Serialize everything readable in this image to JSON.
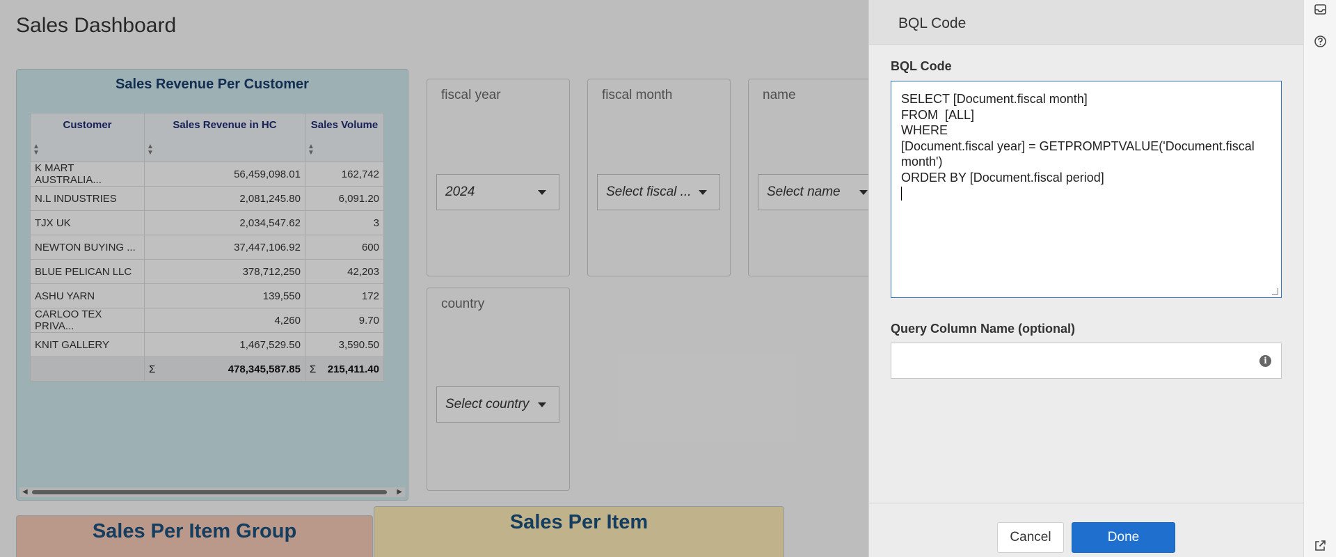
{
  "dashboard": {
    "title": "Sales Dashboard",
    "revenue_panel": {
      "title": "Sales Revenue Per Customer",
      "columns": [
        "Customer",
        "Sales Revenue in HC",
        "Sales Volume"
      ],
      "rows": [
        [
          "K MART AUSTRALIA...",
          "56,459,098.01",
          "162,742"
        ],
        [
          "N.L INDUSTRIES",
          "2,081,245.80",
          "6,091.20"
        ],
        [
          "TJX UK",
          "2,034,547.62",
          "3"
        ],
        [
          "NEWTON BUYING ...",
          "37,447,106.92",
          "600"
        ],
        [
          "BLUE PELICAN LLC",
          "378,712,250",
          "42,203"
        ],
        [
          "ASHU YARN",
          "139,550",
          "172"
        ],
        [
          "CARLOO TEX PRIVA...",
          "4,260",
          "9.70"
        ],
        [
          "KNIT GALLERY",
          "1,467,529.50",
          "3,590.50"
        ]
      ],
      "totals": {
        "sigma": "Σ",
        "revenue": "478,345,587.85",
        "volume": "215,411.40"
      }
    },
    "filters": {
      "fiscal_year": {
        "label": "fiscal year",
        "value": "2024"
      },
      "fiscal_month": {
        "label": "fiscal month",
        "value": "Select fiscal ..."
      },
      "name": {
        "label": "name",
        "value": "Select name"
      },
      "country": {
        "label": "country",
        "value": "Select country"
      }
    },
    "sales_per_item_group": {
      "title": "Sales Per Item Group"
    },
    "sales_per_item": {
      "title": "Sales Per Item"
    }
  },
  "side_panel": {
    "header_title": "BQL Code",
    "bql_label": "BQL Code",
    "bql_code": "SELECT [Document.fiscal month]\nFROM  [ALL]\nWHERE\n[Document.fiscal year] = GETPROMPTVALUE('Document.fiscal month')\nORDER BY [Document.fiscal period]\n",
    "query_column_label": "Query Column Name (optional)",
    "query_column_value": "",
    "cancel_label": "Cancel",
    "done_label": "Done"
  },
  "icons": {
    "inbox": "inbox-icon",
    "help": "help-icon",
    "external_link": "external-link-icon",
    "info": "info-icon"
  },
  "colors": {
    "accent": "#1e6fce",
    "revenue_panel_bg": "#c9e3e8",
    "item_group_bg": "#efc4b3",
    "item_bg": "#f6e6b3"
  }
}
